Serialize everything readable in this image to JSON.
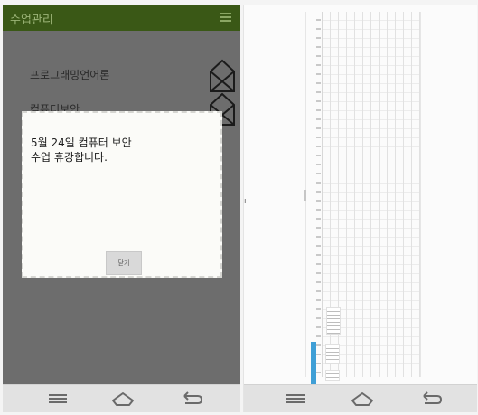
{
  "left_screen": {
    "app_title": "수업관리",
    "list_items": [
      "프로그래밍언어론",
      "컴퓨터보안"
    ],
    "dialog": {
      "message_line1": "5월 24일 컴퓨터 보안",
      "message_line2": "수업 휴강합니다.",
      "button_label": "닫기"
    }
  },
  "nav_icons": [
    "menu-lines-icon",
    "home-icon",
    "back-icon"
  ],
  "colors": {
    "appbar": "#3a5816",
    "overlay": "#6d6d6d",
    "highlight": "#3f9fd6"
  }
}
